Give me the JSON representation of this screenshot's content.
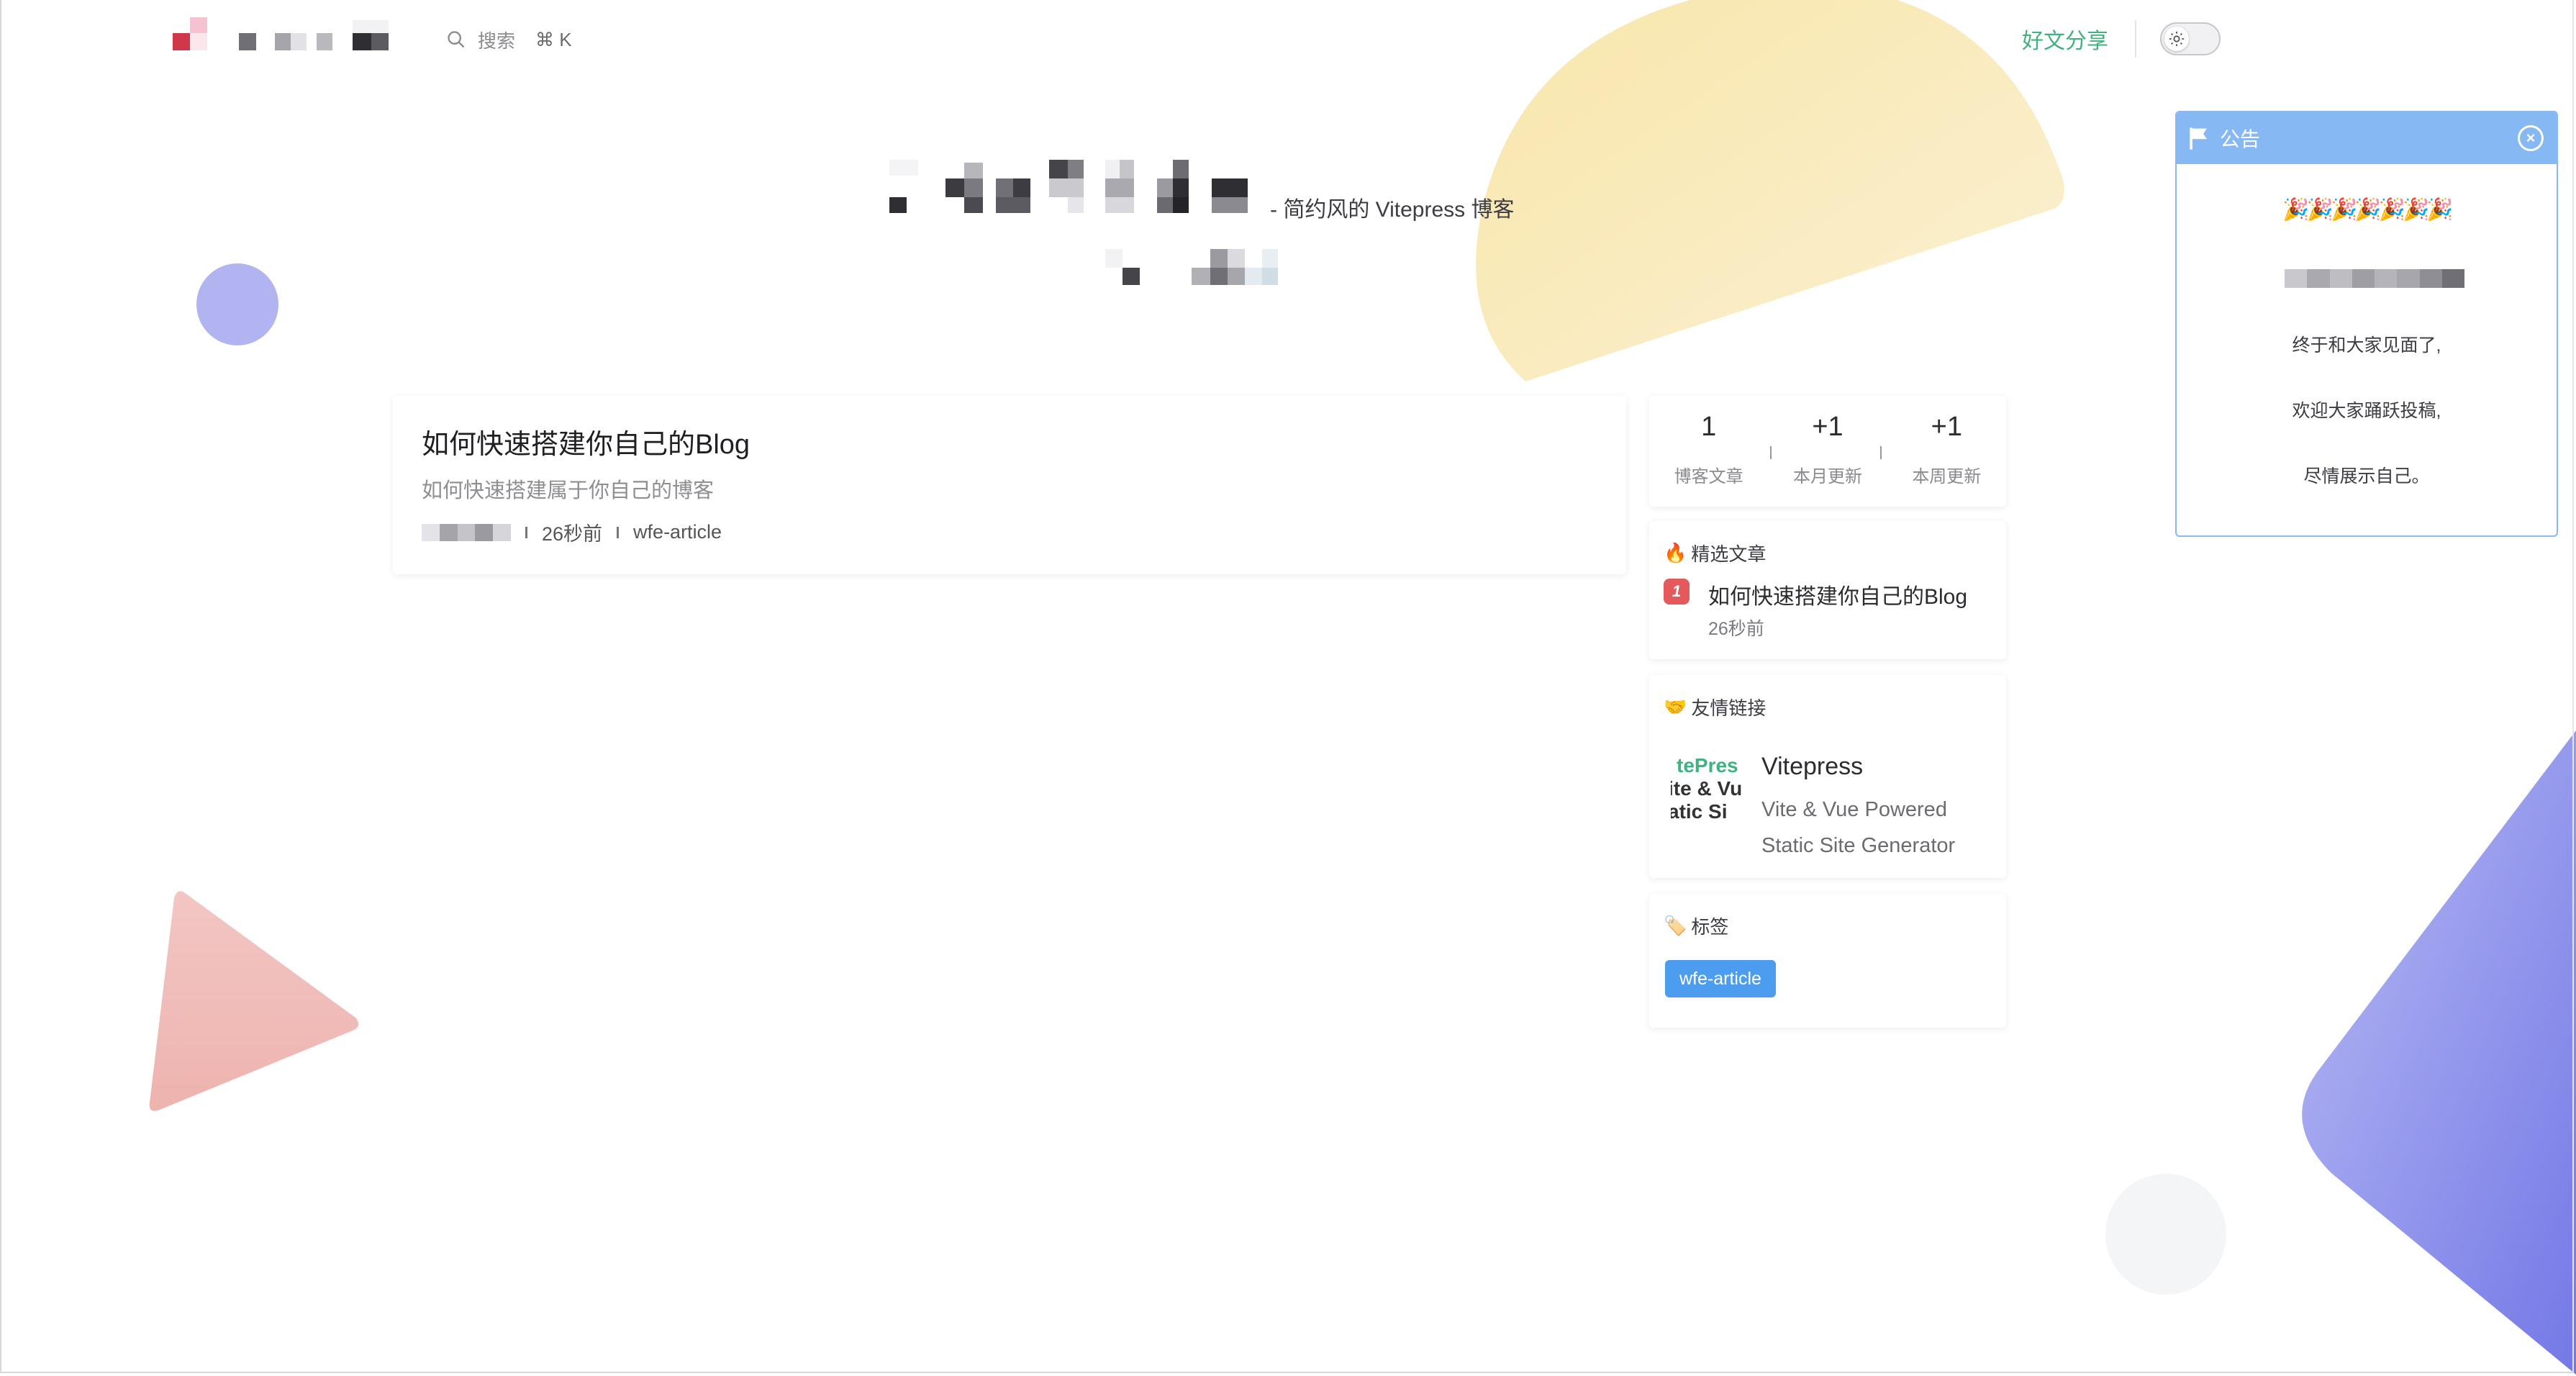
{
  "navbar": {
    "search_placeholder": "搜索",
    "search_shortcut": "⌘ K",
    "link_label": "好文分享"
  },
  "hero": {
    "subtitle": "- 简约风的 Vitepress 博客"
  },
  "post": {
    "title": "如何快速搭建你自己的Blog",
    "description": "如何快速搭建属于你自己的博客",
    "time": "26秒前",
    "tag": "wfe-article"
  },
  "stats": [
    {
      "value": "1",
      "label": "博客文章"
    },
    {
      "value": "+1",
      "label": "本月更新"
    },
    {
      "value": "+1",
      "label": "本周更新"
    }
  ],
  "featured": {
    "heading": "精选文章",
    "heading_icon": "🔥",
    "rank": "1",
    "title": "如何快速搭建你自己的Blog",
    "time": "26秒前"
  },
  "friend_links": {
    "heading": "友情链接",
    "heading_icon": "🤝",
    "thumb_lines": [
      "tePres",
      "ite & Vu",
      "atic Si"
    ],
    "name": "Vitepress",
    "desc_line1": "Vite & Vue Powered",
    "desc_line2": "Static Site Generator"
  },
  "tags": {
    "heading": "标签",
    "heading_icon": "🏷️",
    "items": [
      "wfe-article"
    ]
  },
  "announcement": {
    "title": "公告",
    "confetti": "🎉🎉🎉🎉🎉🎉🎉",
    "line1": "终于和大家见面了,",
    "line2": "欢迎大家踊跃投稿,",
    "line3": "尽情展示自己。"
  },
  "colors": {
    "accent_green": "#3fb27f",
    "tag_blue": "#4c9cf0",
    "announce_blue": "#86b8f3",
    "rank_red": "#e4595b"
  }
}
